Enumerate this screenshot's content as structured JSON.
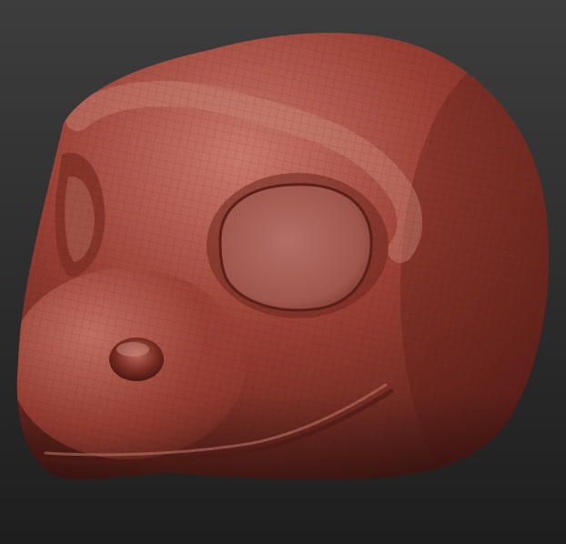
{
  "viewport": {
    "background_top": "#3d3d3d",
    "background_bottom": "#1e1e1e"
  },
  "model": {
    "subject": "reptile-head-sculpt",
    "material_base": "#9a3f33",
    "material_light": "#c8786a",
    "material_dark": "#4e1a14",
    "wireframe_visible": true,
    "wireframe_color": "#3a120d"
  }
}
